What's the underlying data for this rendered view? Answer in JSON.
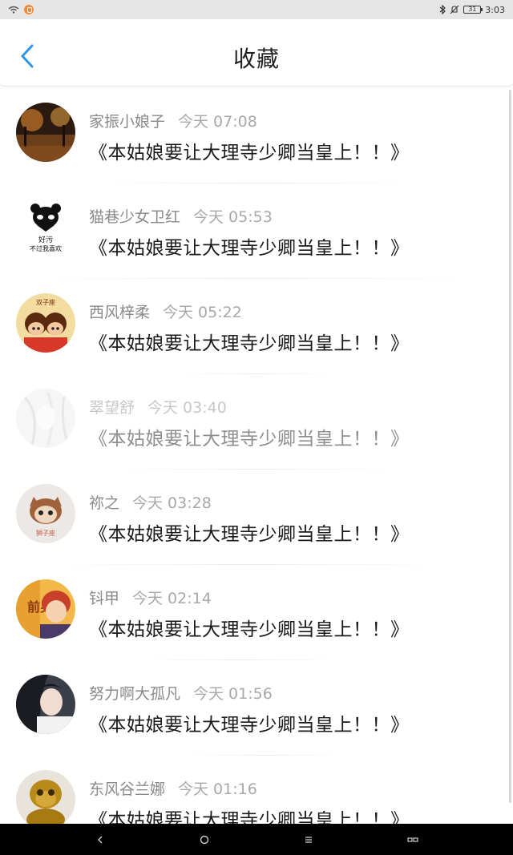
{
  "status_bar": {
    "time": "3:03",
    "battery": "31"
  },
  "header": {
    "title": "收藏"
  },
  "items": [
    {
      "name": "家振小娘子",
      "time": "今天 07:08",
      "title": "《本姑娘要让大理寺少卿当皇上！！》"
    },
    {
      "name": "猫巷少女卫红",
      "time": "今天 05:53",
      "title": "《本姑娘要让大理寺少卿当皇上！！》",
      "avatar_text_1": "好污",
      "avatar_text_2": "不过我喜欢"
    },
    {
      "name": "西风梓柔",
      "time": "今天 05:22",
      "title": "《本姑娘要让大理寺少卿当皇上！！》",
      "avatar_text_1": "双子座"
    },
    {
      "name": "翠望舒",
      "time": "今天 03:40",
      "title": "《本姑娘要让大理寺少卿当皇上！！》"
    },
    {
      "name": "祢之",
      "time": "今天 03:28",
      "title": "《本姑娘要让大理寺少卿当皇上！！》",
      "avatar_text_1": "狮子座"
    },
    {
      "name": "钭甲",
      "time": "今天 02:14",
      "title": "《本姑娘要让大理寺少卿当皇上！！》",
      "avatar_text_1": "前男"
    },
    {
      "name": "努力啊大孤凡",
      "time": "今天 01:56",
      "title": "《本姑娘要让大理寺少卿当皇上！！》"
    },
    {
      "name": "东风谷兰娜",
      "time": "今天 01:16",
      "title": "《本姑娘要让大理寺少卿当皇上！！》"
    }
  ]
}
